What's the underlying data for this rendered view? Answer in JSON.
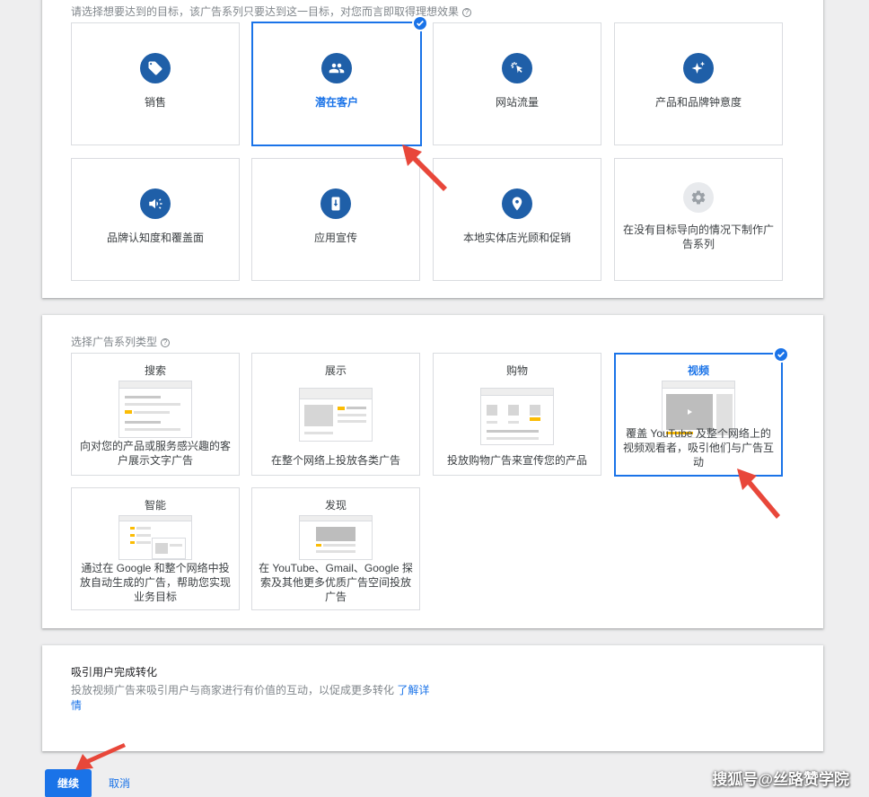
{
  "goals_section": {
    "hint": "请选择想要达到的目标，该广告系列只要达到这一目标，对您而言即取得理想效果",
    "tiles": [
      {
        "label": "销售",
        "icon": "tag-icon"
      },
      {
        "label": "潜在客户",
        "icon": "people-icon",
        "selected": true
      },
      {
        "label": "网站流量",
        "icon": "cursor-click-icon"
      },
      {
        "label": "产品和品牌钟意度",
        "icon": "sparkle-icon"
      },
      {
        "label": "品牌认知度和覆盖面",
        "icon": "megaphone-icon"
      },
      {
        "label": "应用宣传",
        "icon": "phone-download-icon"
      },
      {
        "label": "本地实体店光顾和促销",
        "icon": "location-pin-icon"
      },
      {
        "label": "在没有目标导向的情况下制作广告系列",
        "icon": "gear-icon"
      }
    ]
  },
  "types_section": {
    "hint": "选择广告系列类型",
    "tiles": [
      {
        "title": "搜索",
        "desc": "向对您的产品或服务感兴趣的客户展示文字广告"
      },
      {
        "title": "展示",
        "desc": "在整个网络上投放各类广告"
      },
      {
        "title": "购物",
        "desc": "投放购物广告来宣传您的产品"
      },
      {
        "title": "视频",
        "desc": "覆盖 YouTube 及整个网络上的视频观看者，吸引他们与广告互动",
        "selected": true
      },
      {
        "title": "智能",
        "desc": "通过在 Google 和整个网络中投放自动生成的广告，帮助您实现业务目标"
      },
      {
        "title": "发现",
        "desc": "在 YouTube、Gmail、Google 探索及其他更多优质广告空间投放广告"
      }
    ]
  },
  "conversion_section": {
    "title": "吸引用户完成转化",
    "text": "投放视频广告来吸引用户与商家进行有价值的互动，以促成更多转化",
    "link": "了解详情"
  },
  "footer": {
    "continue_label": "继续",
    "cancel_label": "取消"
  },
  "watermark": "搜狐号@丝路赞学院",
  "colors": {
    "accent": "#1a73e8",
    "icon_circle": "#1f5fa8",
    "arrow": "#e8473a",
    "highlight": "#fbbc04"
  }
}
